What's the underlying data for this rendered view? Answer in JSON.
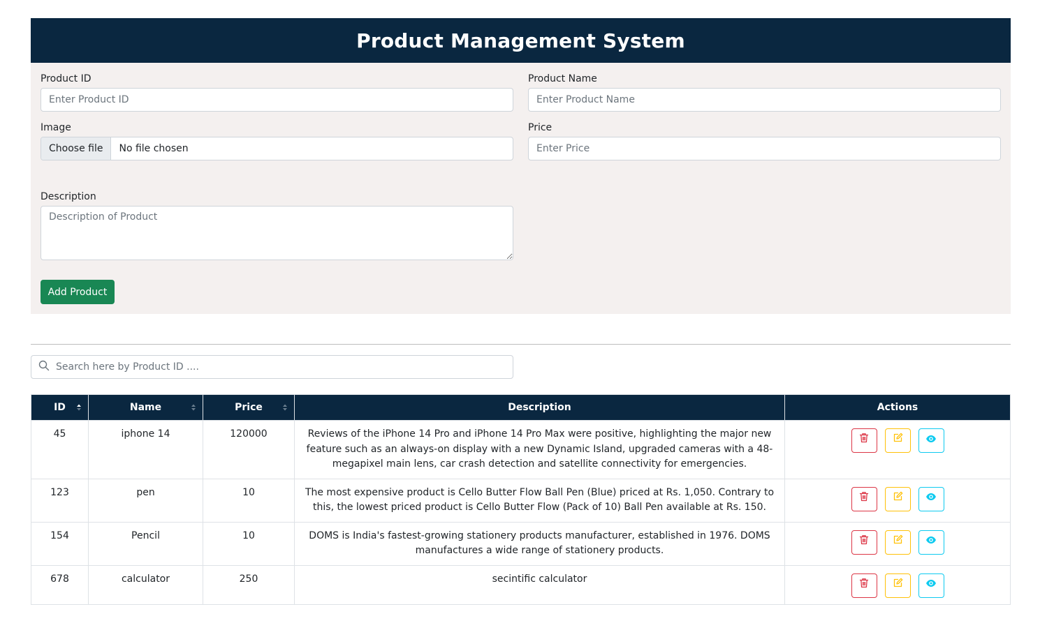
{
  "header": {
    "title": "Product Management System"
  },
  "form": {
    "product_id": {
      "label": "Product ID",
      "placeholder": "Enter Product ID"
    },
    "product_name": {
      "label": "Product Name",
      "placeholder": "Enter Product Name"
    },
    "image": {
      "label": "Image",
      "button": "Choose file",
      "status": "No file chosen"
    },
    "price": {
      "label": "Price",
      "placeholder": "Enter Price"
    },
    "description": {
      "label": "Description",
      "placeholder": "Description of Product"
    },
    "submit_label": "Add Product"
  },
  "search": {
    "placeholder": "Search here by Product ID ...."
  },
  "table": {
    "columns": [
      "ID",
      "Name",
      "Price",
      "Description",
      "Actions"
    ],
    "rows": [
      {
        "id": "45",
        "name": "iphone 14",
        "price": "120000",
        "description": "Reviews of the iPhone 14 Pro and iPhone 14 Pro Max were positive, highlighting the major new feature such as an always-on display with a new Dynamic Island, upgraded cameras with a 48-megapixel main lens, car crash detection and satellite connectivity for emergencies."
      },
      {
        "id": "123",
        "name": "pen",
        "price": "10",
        "description": "The most expensive product is Cello Butter Flow Ball Pen (Blue) priced at Rs. 1,050. Contrary to this, the lowest priced product is Cello Butter Flow (Pack of 10) Ball Pen available at Rs. 150."
      },
      {
        "id": "154",
        "name": "Pencil",
        "price": "10",
        "description": "DOMS is India's fastest-growing stationery products manufacturer, established in 1976. DOMS manufactures a wide range of stationery products."
      },
      {
        "id": "678",
        "name": "calculator",
        "price": "250",
        "description": "secintific calculator"
      }
    ]
  },
  "colors": {
    "header_bg": "#0a2740",
    "form_bg": "#f4f0ef",
    "add_button": "#198754",
    "delete": "#dc3545",
    "edit": "#ffc107",
    "view": "#0dcaf0"
  },
  "icons": {
    "delete": "trash-icon",
    "edit": "edit-icon",
    "view": "eye-icon",
    "search": "search-icon",
    "sort": "sort-icon"
  }
}
